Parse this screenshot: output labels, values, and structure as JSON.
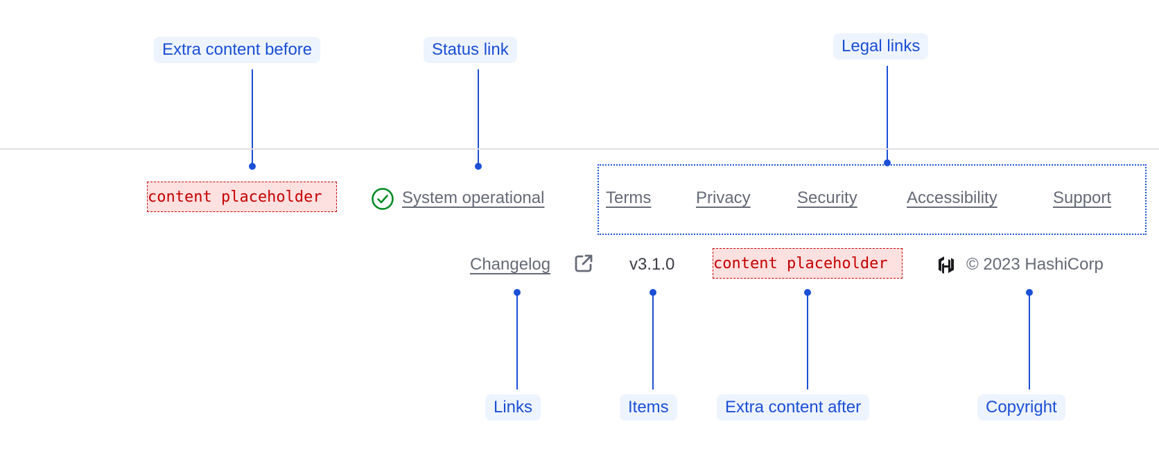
{
  "callouts": {
    "extra_before": "Extra content before",
    "status_link": "Status link",
    "legal_links": "Legal links",
    "links": "Links",
    "items": "Items",
    "extra_after": "Extra content after",
    "copyright": "Copyright"
  },
  "footer": {
    "extra_before_placeholder": "content placeholder",
    "status": {
      "icon": "check-circle-icon",
      "label": "System operational",
      "color": "#008a22"
    },
    "legal_links": [
      "Terms",
      "Privacy",
      "Security",
      "Accessibility",
      "Support"
    ],
    "links": [
      {
        "label": "Changelog",
        "icon": "external-link-icon"
      }
    ],
    "items": [
      "v3.1.0"
    ],
    "extra_after_placeholder": "content placeholder",
    "copyright": {
      "logo": "hashicorp-logo-icon",
      "text": "© 2023 HashiCorp"
    }
  }
}
